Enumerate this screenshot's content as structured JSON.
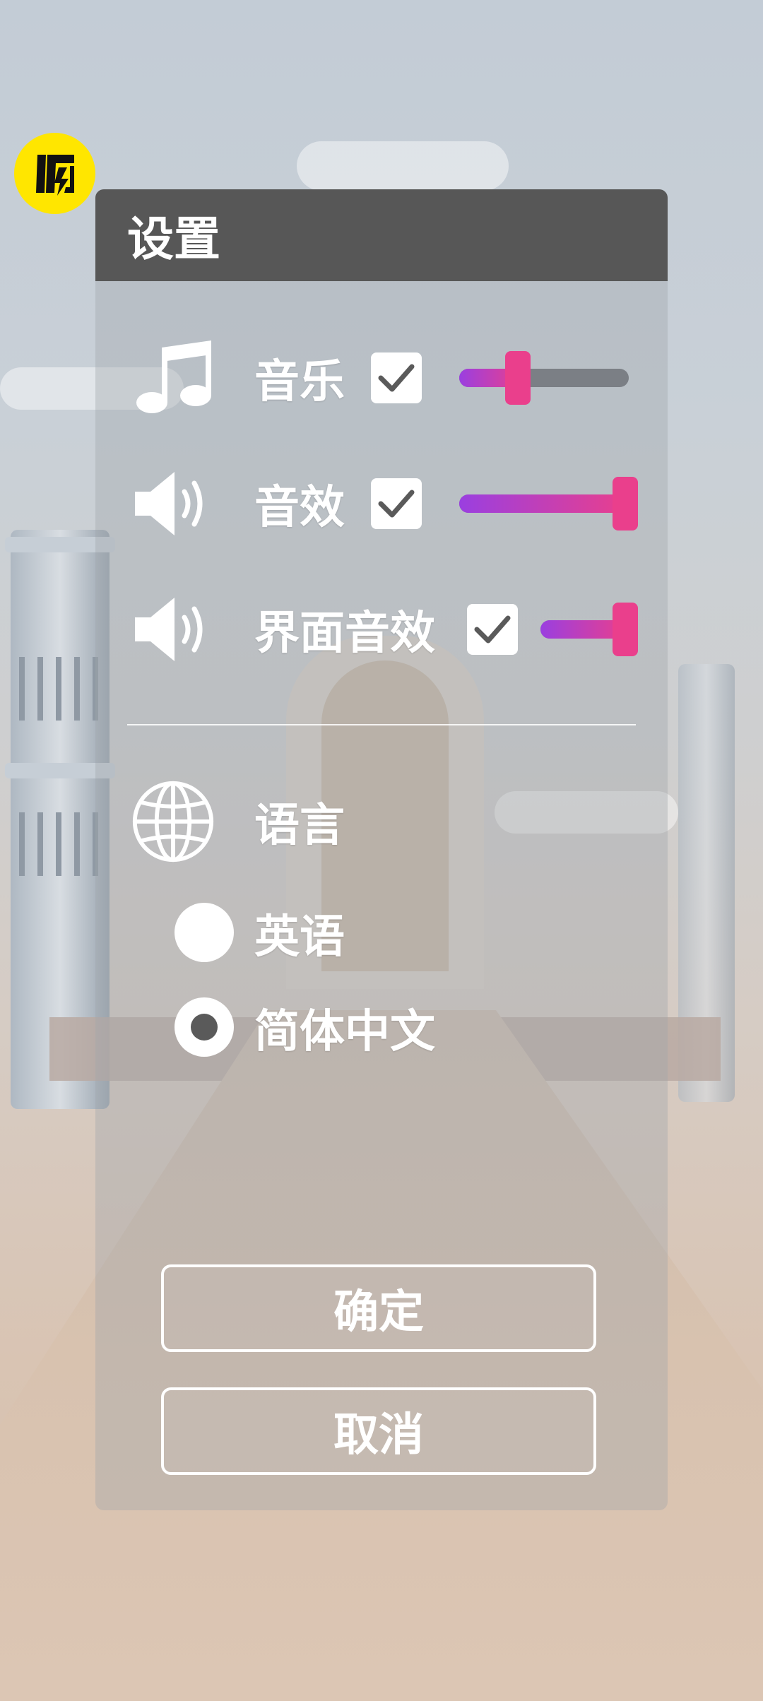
{
  "logo": {
    "icon": "flash-app-logo",
    "color": "#ffe600"
  },
  "settings": {
    "title": "设置",
    "audio": [
      {
        "label": "音乐",
        "icon": "music-note-icon",
        "checked": true,
        "volume": 0.33
      },
      {
        "label": "音效",
        "icon": "speaker-icon",
        "checked": true,
        "volume": 1.0
      },
      {
        "label": "界面音效",
        "icon": "speaker-icon",
        "checked": true,
        "volume": 1.0
      }
    ],
    "language": {
      "label": "语言",
      "icon": "globe-icon",
      "options": [
        {
          "label": "英语",
          "selected": false
        },
        {
          "label": "简体中文",
          "selected": true
        }
      ]
    },
    "buttons": {
      "confirm": "确定",
      "cancel": "取消"
    }
  },
  "colors": {
    "slider_start": "#9a3fe0",
    "slider_end": "#ea3f8c",
    "header": "#575757"
  }
}
